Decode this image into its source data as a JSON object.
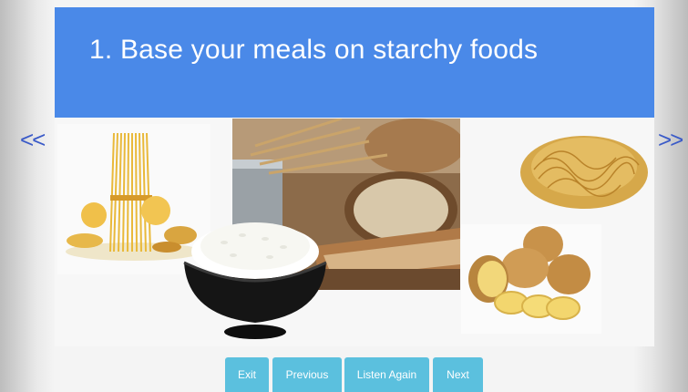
{
  "slide": {
    "title": "1. Base your meals on starchy foods"
  },
  "navigation": {
    "prev_arrow": "<<",
    "next_arrow": ">>"
  },
  "images": [
    {
      "name": "pasta",
      "icon": "pasta-image"
    },
    {
      "name": "bread-and-wheat",
      "icon": "bread-image"
    },
    {
      "name": "noodles",
      "icon": "noodles-image"
    },
    {
      "name": "potatoes",
      "icon": "potatoes-image"
    },
    {
      "name": "rice-bowl",
      "icon": "rice-image"
    }
  ],
  "buttons": {
    "exit": "Exit",
    "previous": "Previous",
    "listen_again": "Listen Again",
    "next": "Next"
  },
  "colors": {
    "title_bar": "#4a89e8",
    "button": "#5bc0de",
    "arrow": "#3b5bc8"
  }
}
